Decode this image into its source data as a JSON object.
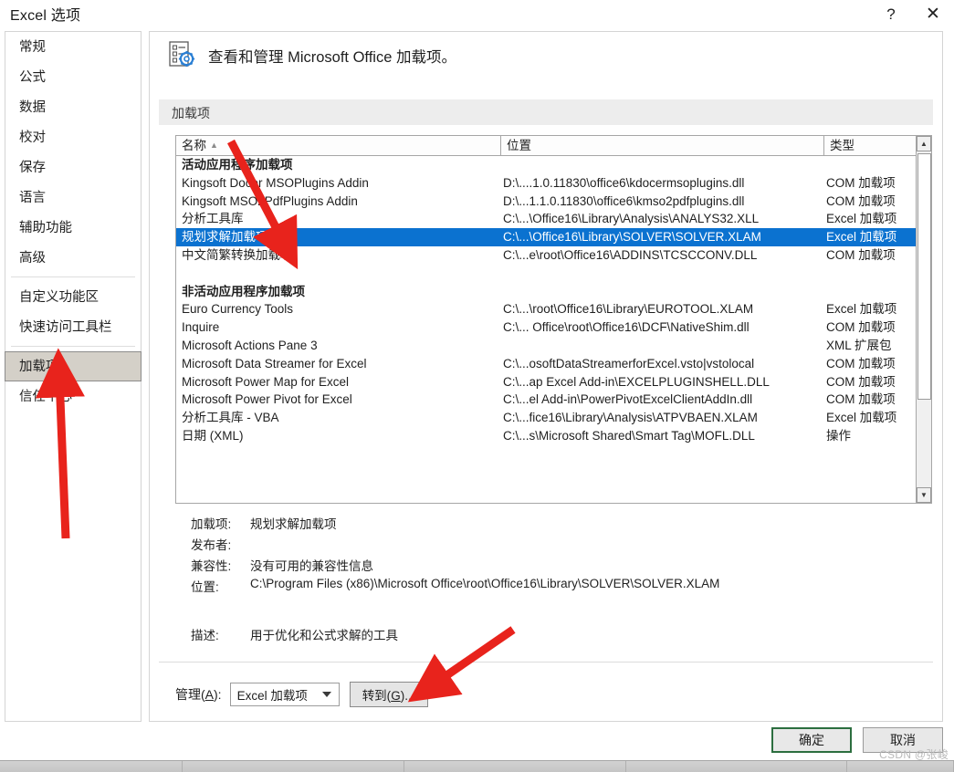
{
  "window": {
    "title": "Excel 选项",
    "help_icon": "?",
    "close_icon": "✕"
  },
  "sidebar": {
    "items": [
      {
        "label": "常规",
        "selected": false
      },
      {
        "label": "公式",
        "selected": false
      },
      {
        "label": "数据",
        "selected": false
      },
      {
        "label": "校对",
        "selected": false
      },
      {
        "label": "保存",
        "selected": false
      },
      {
        "label": "语言",
        "selected": false
      },
      {
        "label": "辅助功能",
        "selected": false
      },
      {
        "label": "高级",
        "selected": false
      },
      {
        "label": "自定义功能区",
        "selected": false
      },
      {
        "label": "快速访问工具栏",
        "selected": false
      },
      {
        "label": "加载项",
        "selected": true
      },
      {
        "label": "信任中心",
        "selected": false
      }
    ]
  },
  "pane": {
    "header_title": "查看和管理 Microsoft Office 加载项。",
    "header_icon": "addins-gear-icon",
    "section_label": "加载项"
  },
  "table": {
    "columns": [
      {
        "label": "名称",
        "sorted": true,
        "sort_caret": "▲"
      },
      {
        "label": "位置",
        "sorted": false,
        "sort_caret": ""
      },
      {
        "label": "类型",
        "sorted": false,
        "sort_caret": ""
      }
    ],
    "rows": [
      {
        "kind": "group",
        "name": "活动应用程序加载项",
        "location": "",
        "type": "",
        "selected": false
      },
      {
        "kind": "item",
        "name": "Kingsoft Docer MSOPlugins Addin",
        "location": "D:\\....1.0.11830\\office6\\kdocermsoplugins.dll",
        "type": "COM 加载项",
        "selected": false
      },
      {
        "kind": "item",
        "name": "Kingsoft MSO2PdfPlugins Addin",
        "location": "D:\\...1.1.0.11830\\office6\\kmso2pdfplugins.dll",
        "type": "COM 加载项",
        "selected": false
      },
      {
        "kind": "item",
        "name": "分析工具库",
        "location": "C:\\...\\Office16\\Library\\Analysis\\ANALYS32.XLL",
        "type": "Excel 加载项",
        "selected": false
      },
      {
        "kind": "item",
        "name": "规划求解加载项",
        "location": "C:\\...\\Office16\\Library\\SOLVER\\SOLVER.XLAM",
        "type": "Excel 加载项",
        "selected": true
      },
      {
        "kind": "item",
        "name": "中文简繁转换加载项",
        "location": "C:\\...e\\root\\Office16\\ADDINS\\TCSCCONV.DLL",
        "type": "COM 加载项",
        "selected": false
      },
      {
        "kind": "spacer",
        "name": "",
        "location": "",
        "type": "",
        "selected": false
      },
      {
        "kind": "group",
        "name": "非活动应用程序加载项",
        "location": "",
        "type": "",
        "selected": false
      },
      {
        "kind": "item",
        "name": "Euro Currency Tools",
        "location": "C:\\...\\root\\Office16\\Library\\EUROTOOL.XLAM",
        "type": "Excel 加载项",
        "selected": false
      },
      {
        "kind": "item",
        "name": "Inquire",
        "location": "C:\\... Office\\root\\Office16\\DCF\\NativeShim.dll",
        "type": "COM 加载项",
        "selected": false
      },
      {
        "kind": "item",
        "name": "Microsoft Actions Pane 3",
        "location": "",
        "type": "XML 扩展包",
        "selected": false
      },
      {
        "kind": "item",
        "name": "Microsoft Data Streamer for Excel",
        "location": "C:\\...osoftDataStreamerforExcel.vsto|vstolocal",
        "type": "COM 加载项",
        "selected": false
      },
      {
        "kind": "item",
        "name": "Microsoft Power Map for Excel",
        "location": "C:\\...ap Excel Add-in\\EXCELPLUGINSHELL.DLL",
        "type": "COM 加载项",
        "selected": false
      },
      {
        "kind": "item",
        "name": "Microsoft Power Pivot for Excel",
        "location": "C:\\...el Add-in\\PowerPivotExcelClientAddIn.dll",
        "type": "COM 加载项",
        "selected": false
      },
      {
        "kind": "item",
        "name": "分析工具库 - VBA",
        "location": "C:\\...fice16\\Library\\Analysis\\ATPVBAEN.XLAM",
        "type": "Excel 加载项",
        "selected": false
      },
      {
        "kind": "item",
        "name": "日期 (XML)",
        "location": "C:\\...s\\Microsoft Shared\\Smart Tag\\MOFL.DLL",
        "type": "操作",
        "selected": false
      }
    ],
    "scrollbar": {
      "up_arrow": "▲",
      "down_arrow": "▼"
    }
  },
  "details": {
    "addin_label": "加载项:",
    "addin_value": "规划求解加载项",
    "publisher_label": "发布者:",
    "publisher_value": "",
    "compat_label": "兼容性:",
    "compat_value": "没有可用的兼容性信息",
    "location_label": "位置:",
    "location_value": "C:\\Program Files (x86)\\Microsoft Office\\root\\Office16\\Library\\SOLVER\\SOLVER.XLAM",
    "desc_label": "描述:",
    "desc_value": "用于优化和公式求解的工具"
  },
  "manage": {
    "label_prefix": "管理(",
    "label_key": "A",
    "label_suffix": "):",
    "selected_option": "Excel 加载项",
    "options": [
      "Excel 加载项"
    ],
    "goto_prefix": "转到(",
    "goto_key": "G",
    "goto_suffix": ")..."
  },
  "footer": {
    "ok_label": "确定",
    "cancel_label": "取消"
  },
  "watermark": {
    "text": "CSDN @张峻"
  },
  "colors": {
    "selection_blue": "#0b72d0",
    "nav_selected_bg": "#d4d0c8",
    "section_band": "#ededed",
    "ok_border_green": "#2c6e3f",
    "arrow_red": "#e8231c",
    "icon_blue": "#2a7fd4"
  }
}
